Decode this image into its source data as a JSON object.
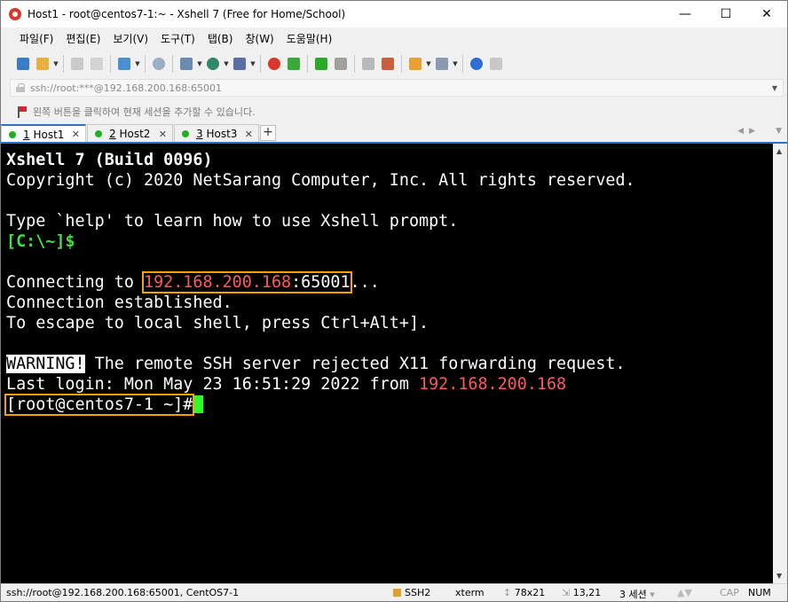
{
  "window": {
    "title": "Host1 - root@centos7-1:~ - Xshell 7 (Free for Home/School)",
    "minimize": "—",
    "maximize": "☐",
    "close": "✕"
  },
  "menu": [
    "파일(F)",
    "편집(E)",
    "보기(V)",
    "도구(T)",
    "탭(B)",
    "창(W)",
    "도움말(H)"
  ],
  "address": {
    "text": "ssh://root:***@192.168.200.168:65001"
  },
  "hint": "왼쪽 버튼을 클릭하여 현재 세션을 추가할 수 있습니다.",
  "tabs": [
    {
      "num": "1",
      "name": " Host1"
    },
    {
      "num": "2",
      "name": " Host2"
    },
    {
      "num": "3",
      "name": " Host3"
    }
  ],
  "tab_add": "+",
  "terminal": {
    "l1": "Xshell 7 (Build 0096)",
    "l2": "Copyright (c) 2020 NetSarang Computer, Inc. All rights reserved.",
    "l3": "Type `help' to learn how to use Xshell prompt.",
    "l4": "[C:\\~]$",
    "l5_pre": "Connecting to ",
    "l5_ip": "192.168.200.168",
    "l5_port": ":65001",
    "l5_post": "...",
    "l6": "Connection established.",
    "l7": "To escape to local shell, press Ctrl+Alt+].",
    "l8_warn": "WARNING!",
    "l8_rest": " The remote SSH server rejected X11 forwarding request.",
    "l9_pre": "Last login: Mon May 23 16:51:29 2022 from ",
    "l9_ip": "192.168.200.168",
    "l10": "[root@centos7-1 ~]#"
  },
  "status": {
    "session": "ssh://root@192.168.200.168:65001, CentOS7-1",
    "protocol": "SSH2",
    "term": "xterm",
    "size": "78x21",
    "pos": "13,21",
    "sessions": "3 세션",
    "cap": "CAP",
    "num": "NUM"
  },
  "colors": {
    "prompt": "#3ee03e",
    "ip": "#ff5a5a",
    "highlight": "#f5a300",
    "cursor": "#2bff2b",
    "tab_accent": "#2b6fd1"
  }
}
